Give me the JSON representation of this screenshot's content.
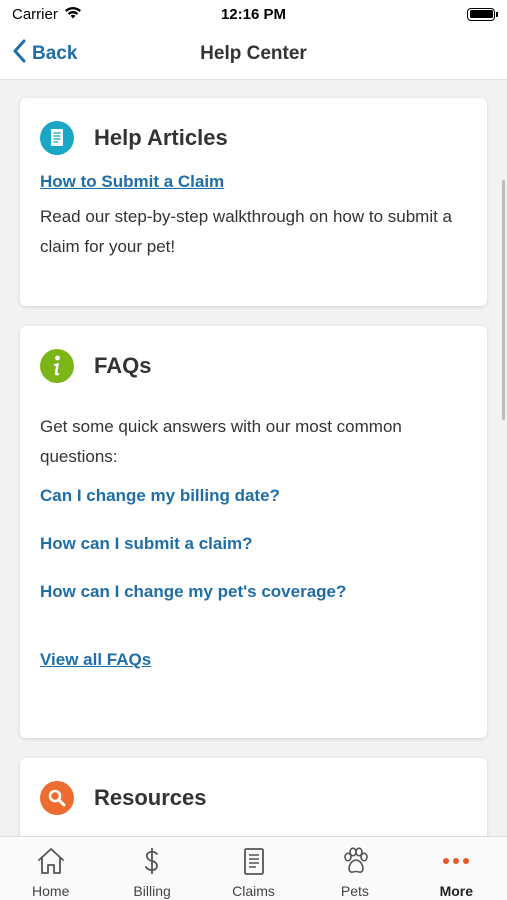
{
  "status_bar": {
    "carrier": "Carrier",
    "time": "12:16 PM"
  },
  "nav": {
    "back_label": "Back",
    "title": "Help Center"
  },
  "help_articles": {
    "title": "Help Articles",
    "link": "How to Submit a Claim",
    "description": "Read our step-by-step walkthrough on how to submit a claim for your pet!"
  },
  "faqs": {
    "title": "FAQs",
    "intro": "Get some quick answers with our most common questions:",
    "questions": [
      "Can I change my billing date?",
      "How can I submit a claim?",
      "How can I change my pet's coverage?"
    ],
    "view_all": "View all FAQs"
  },
  "resources": {
    "title": "Resources"
  },
  "tabs": [
    {
      "label": "Home",
      "icon": "home-icon"
    },
    {
      "label": "Billing",
      "icon": "dollar-icon"
    },
    {
      "label": "Claims",
      "icon": "document-icon"
    },
    {
      "label": "Pets",
      "icon": "paw-icon"
    },
    {
      "label": "More",
      "icon": "more-dots-icon",
      "active": true
    }
  ],
  "colors": {
    "link": "#1f6ea8",
    "articles_icon": "#1aa6c5",
    "faqs_icon": "#7cb518",
    "resources_icon": "#ec6d2f",
    "more_active": "#e8562a"
  }
}
